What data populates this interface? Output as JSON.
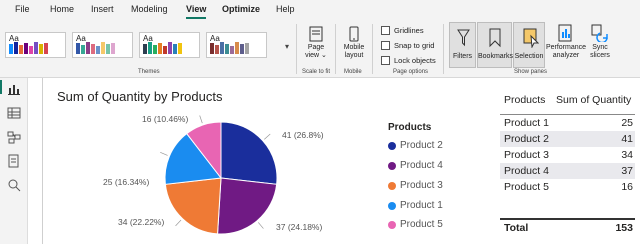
{
  "menu": {
    "items": [
      {
        "label": "File"
      },
      {
        "label": "Home"
      },
      {
        "label": "Insert"
      },
      {
        "label": "Modeling"
      },
      {
        "label": "View"
      },
      {
        "label": "Optimize"
      },
      {
        "label": "Help"
      }
    ],
    "active": "View"
  },
  "ribbon": {
    "themes_label": "Themes",
    "page_view": "Page view ⌄",
    "scale_to_fit": "Scale to fit",
    "mobile_layout": "Mobile layout",
    "mobile": "Mobile",
    "gridlines": "Gridlines",
    "snap_to_grid": "Snap to grid",
    "lock_objects": "Lock objects",
    "page_options": "Page options",
    "filters": "Filters",
    "bookmarks": "Bookmarks",
    "selection": "Selection",
    "performance_analyzer": "Performance analyzer",
    "sync_slicers": "Sync slicers",
    "show_panes": "Show panes",
    "theme_aa": "Aa"
  },
  "chart": {
    "title": "Sum of Quantity by Products",
    "legend_title": "Products",
    "slice_labels": {
      "p2": "41 (26.8%)",
      "p4": "37 (24.18%)",
      "p3": "34 (22.22%)",
      "p1": "25 (16.34%)",
      "p5": "16 (10.46%)"
    }
  },
  "chart_data": {
    "type": "pie",
    "title": "Sum of Quantity by Products",
    "legend_title": "Products",
    "categories": [
      "Product 2",
      "Product 4",
      "Product 3",
      "Product 1",
      "Product 5"
    ],
    "values": [
      41,
      37,
      34,
      25,
      16
    ],
    "percent_labels": [
      "26.8%",
      "24.18%",
      "22.22%",
      "16.34%",
      "10.46%"
    ],
    "colors": [
      "#1a2e9c",
      "#701a84",
      "#ef7a35",
      "#1a8cf0",
      "#e865b3"
    ],
    "legend_placement": "right"
  },
  "table": {
    "header_products": "Products",
    "header_quantity": "Sum of Quantity",
    "rows": [
      {
        "product": "Product 1",
        "qty": "25"
      },
      {
        "product": "Product 2",
        "qty": "41"
      },
      {
        "product": "Product 3",
        "qty": "34"
      },
      {
        "product": "Product 4",
        "qty": "37"
      },
      {
        "product": "Product 5",
        "qty": "16"
      }
    ],
    "total_label": "Total",
    "total_value": "153"
  }
}
